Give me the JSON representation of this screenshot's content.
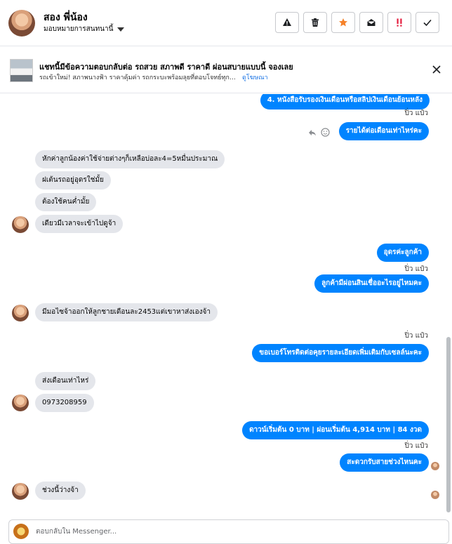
{
  "header": {
    "contact_name": "สอง พี่น้อง",
    "assign_label": "มอบหมายการสนทนานี้",
    "actions": [
      "alert-icon",
      "trash-icon",
      "star-icon",
      "envelope-open-icon",
      "spam-icon",
      "check-icon"
    ],
    "star_color": "#f5822a",
    "spam_color": "#e41e3f"
  },
  "banner": {
    "title": "แชทนี้มีข้อความตอบกลับต่อ รถสวย สภาพดี ราคาดี ผ่อนสบายแบบนี้ จองเลย",
    "subtitle": "รถเข้าใหม่! สภาพนางฟ้า ราคาคุ้มค่า รถกระบะพร้อมลุยที่ตอบโจทย์ทุกการใ...",
    "link": "ดูโฆษณา"
  },
  "messages": {
    "m1": "4. หนังสือรับรองเงินเดือนหรือสลิปเงินเดือนย้อนหลัง",
    "seen1": "ปิ่ว แป๋ว",
    "m2": "รายได้ต่อเดือนเท่าไหร่คะ",
    "m3": "หักค่าลูกน้องค่าใช้จ่ายต่างๆก็เหลือบ่อละ4=5หมื่นประมาณ",
    "m4": "ฝเต้นรถอยู่อุดรใช่มั้ย",
    "m5": "ต้องใช้คนค่ำมั้ย",
    "m6": "เดียวมีเวลาจะเข้าไปดูจ้า",
    "m7": "อุดรค่ะลูกค้า",
    "seen2": "ปิ่ว แป๋ว",
    "m8": "ลูกค้ามีผ่อนสินเชื่ออะไรอยู่ไหมคะ",
    "m9": "มีมอไซจ้าออกให้ลูกชายเดือนละ2453แต่เขาหาส่งเองจ้า",
    "seen3": "ปิ่ว แป๋ว",
    "m10": "ขอเบอร์โทรติดต่อคุยรายละเอียดเพิ่มเติมกับเซลล์นะคะ",
    "m11": "ส่งเดือนเท่าไหร่",
    "m12": "0973208959",
    "m13": "ดาวน์เริ่มต้น 0 บาท | ผ่อนเริ่มต้น 4,914 บาท | 84 งวด",
    "seen4": "ปิ่ว แป๋ว",
    "m14": "สะดวกรับสายช่วงไหนคะ",
    "m15": "ช่วงนี้ว่างจ้า"
  },
  "composer": {
    "placeholder": "ตอบกลับใน Messenger..."
  },
  "colors": {
    "outgoing_bubble": "#0084ff",
    "incoming_bubble": "#e4e6eb",
    "link": "#1b74e4"
  }
}
